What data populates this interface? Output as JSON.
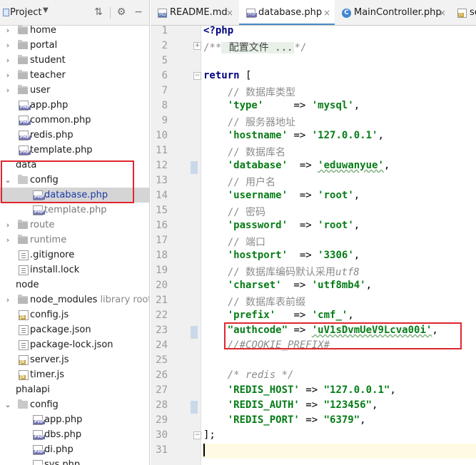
{
  "project_panel": {
    "title": "Project",
    "tree": [
      {
        "label": "home",
        "kind": "folder",
        "indent": 0,
        "expanded": false
      },
      {
        "label": "portal",
        "kind": "folder",
        "indent": 0,
        "expanded": false
      },
      {
        "label": "student",
        "kind": "folder",
        "indent": 0,
        "expanded": false
      },
      {
        "label": "teacher",
        "kind": "folder",
        "indent": 0,
        "expanded": false
      },
      {
        "label": "user",
        "kind": "folder",
        "indent": 0,
        "expanded": false
      },
      {
        "label": "app.php",
        "kind": "php",
        "indent": 0
      },
      {
        "label": "common.php",
        "kind": "php",
        "indent": 0
      },
      {
        "label": "redis.php",
        "kind": "php",
        "indent": 0
      },
      {
        "label": "template.php",
        "kind": "php",
        "indent": 0
      },
      {
        "label": "data",
        "kind": "root",
        "indent": -1,
        "expanded": true
      },
      {
        "label": "config",
        "kind": "folder",
        "indent": 0,
        "expanded": true
      },
      {
        "label": "database.php",
        "kind": "php",
        "indent": 1,
        "selected": true
      },
      {
        "label": "template.php",
        "kind": "php",
        "indent": 1,
        "gray": true
      },
      {
        "label": "route",
        "kind": "folder",
        "indent": 0,
        "expanded": false,
        "gray": true
      },
      {
        "label": "runtime",
        "kind": "folder",
        "indent": 0,
        "expanded": false,
        "gray": true
      },
      {
        "label": ".gitignore",
        "kind": "text",
        "indent": 0
      },
      {
        "label": "install.lock",
        "kind": "text",
        "indent": 0
      },
      {
        "label": "node",
        "kind": "root",
        "indent": -1,
        "expanded": true
      },
      {
        "label": "node_modules",
        "kind": "folder",
        "indent": 0,
        "expanded": false,
        "extra": "library root"
      },
      {
        "label": "config.js",
        "kind": "js",
        "indent": 0
      },
      {
        "label": "package.json",
        "kind": "json",
        "indent": 0
      },
      {
        "label": "package-lock.json",
        "kind": "json",
        "indent": 0
      },
      {
        "label": "server.js",
        "kind": "js",
        "indent": 0
      },
      {
        "label": "timer.js",
        "kind": "js",
        "indent": 0
      },
      {
        "label": "phalapi",
        "kind": "root",
        "indent": -1,
        "expanded": true
      },
      {
        "label": "config",
        "kind": "folder",
        "indent": 0,
        "expanded": true
      },
      {
        "label": "app.php",
        "kind": "php",
        "indent": 1
      },
      {
        "label": "dbs.php",
        "kind": "php",
        "indent": 1
      },
      {
        "label": "di.php",
        "kind": "php",
        "indent": 1
      },
      {
        "label": "sys.php",
        "kind": "php",
        "indent": 1
      }
    ]
  },
  "tabs": [
    {
      "label": "README.md",
      "icon_text": "MD"
    },
    {
      "label": "database.php",
      "icon_text": "PHP",
      "active": true
    },
    {
      "label": "MainController.php",
      "icon_text": "C"
    },
    {
      "label": "ser",
      "icon_text": "JS"
    }
  ],
  "editor": {
    "line_numbers": [
      "1",
      "2",
      "5",
      "6",
      "7",
      "8",
      "9",
      "10",
      "11",
      "12",
      "13",
      "14",
      "15",
      "16",
      "17",
      "18",
      "19",
      "20",
      "21",
      "22",
      "23",
      "24",
      "25",
      "26",
      "27",
      "28",
      "29",
      "30",
      "31"
    ],
    "lines": {
      "l1": "<?php",
      "l2_a": "/**",
      "l2_b": " 配置文件 ...",
      "l2_c": "*/",
      "l6_a": "return",
      "l6_b": " [",
      "l7": "    // 数据库类型",
      "l8_k": "'type'",
      "l8_op": "     => ",
      "l8_v": "'mysql'",
      "l9": "    // 服务器地址",
      "l10_k": "'hostname'",
      "l10_op": " => ",
      "l10_v": "'127.0.0.1'",
      "l11": "    // 数据库名",
      "l12_k": "'database'",
      "l12_op": "  => ",
      "l12_v": "'eduwanyue'",
      "l13": "    // 用户名",
      "l14_k": "'username'",
      "l14_op": "  => ",
      "l14_v": "'root'",
      "l15": "    // 密码",
      "l16_k": "'password'",
      "l16_op": "  => ",
      "l16_v": "'root'",
      "l17": "    // 端口",
      "l18_k": "'hostport'",
      "l18_op": "  => ",
      "l18_v": "'3306'",
      "l19_a": "    // 数据库编码默认采用",
      "l19_b": "utf8",
      "l20_k": "'charset'",
      "l20_op": "  => ",
      "l20_v": "'utf8mb4'",
      "l21": "    // 数据库表前缀",
      "l22_k": "'prefix'",
      "l22_op": "   => ",
      "l22_v": "'cmf_'",
      "l23_k": "\"authcode\"",
      "l23_op": " => ",
      "l23_v": "'uV1sDvmUeV9Lcva00i'",
      "l24": "    //#COOKIE_PREFIX#",
      "l26": "    /* redis */",
      "l27_k": "'REDIS_HOST'",
      "l27_op": " => ",
      "l27_v": "\"127.0.0.1\"",
      "l28_k": "'REDIS_AUTH'",
      "l28_op": " => ",
      "l28_v": "\"123456\"",
      "l29_k": "'REDIS_PORT'",
      "l29_op": " => ",
      "l29_v": "\"6379\"",
      "l30": "];",
      "comma": ","
    }
  }
}
